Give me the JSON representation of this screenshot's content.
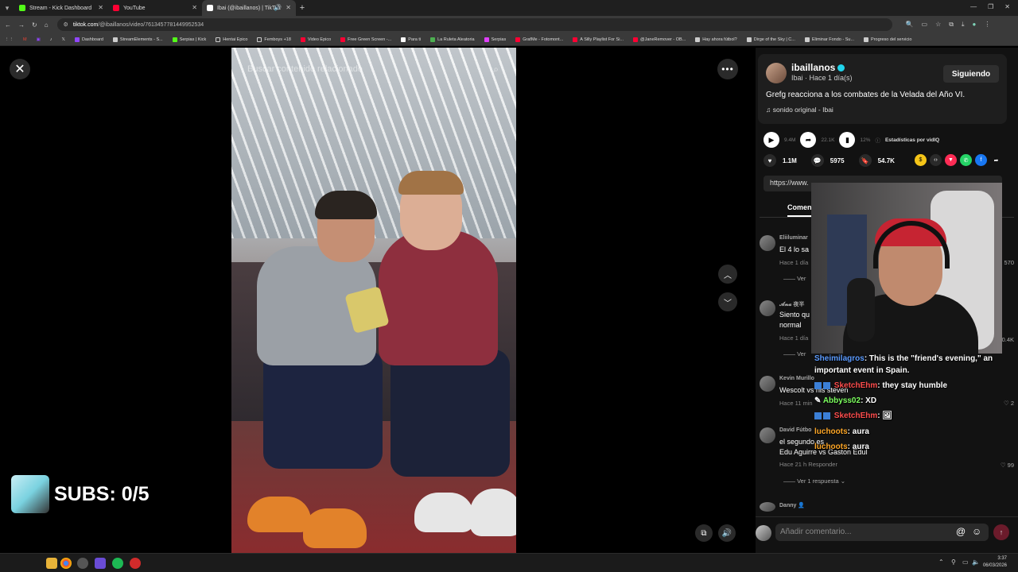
{
  "browser": {
    "tabs": [
      {
        "title": "Stream - Kick Dashboard",
        "color": "#53fc18",
        "active": false
      },
      {
        "title": "YouTube",
        "color": "#ff0033",
        "active": false
      },
      {
        "title": "Ibai (@ibaillanos) | TikTok",
        "color": "#ffffff",
        "active": true
      }
    ],
    "url_host": "tiktok.com",
    "url_path": "/@ibaillanos/video/7613457781449952534",
    "bookmarks": [
      {
        "label": "Dashboard",
        "color": "#9146ff"
      },
      {
        "label": "StreamElements - S...",
        "color": "#cccccc"
      },
      {
        "label": "Serpias | Kick",
        "color": "#53fc18"
      },
      {
        "label": "Hentai Epico",
        "color": "#cccccc"
      },
      {
        "label": "Femboys +18",
        "color": "#cccccc"
      },
      {
        "label": "Video Epico",
        "color": "#ff0033"
      },
      {
        "label": "Free Green Screen -...",
        "color": "#ff0033"
      },
      {
        "label": "Para ti",
        "color": "#ffffff"
      },
      {
        "label": "La Ruleta Aleatoria",
        "color": "#4caf50"
      },
      {
        "label": "Serpias",
        "color": "#e040fb"
      },
      {
        "label": "GrafMe - Fotomont...",
        "color": "#ff0033"
      },
      {
        "label": "A Silly Playlist For Si...",
        "color": "#ff0033"
      },
      {
        "label": "@JaneRemover - OB...",
        "color": "#ff0033"
      },
      {
        "label": "Hay ahora fútbol?",
        "color": "#cccccc"
      },
      {
        "label": "Dirge of the Sky | C...",
        "color": "#cccccc"
      },
      {
        "label": "Eliminar Fondo - Su...",
        "color": "#cccccc"
      },
      {
        "label": "Progreso del servicio",
        "color": "#cccccc"
      }
    ]
  },
  "video": {
    "search_placeholder": "Buscar contenido relacionado"
  },
  "overlay": {
    "subs_text": "SUBS: 0/5"
  },
  "post": {
    "username": "ibaillanos",
    "display_meta": "Ibai · Hace 1 día(s)",
    "follow_label": "Siguiendo",
    "description": "Grefg reacciona a los combates de la Velada del Año VI.",
    "sound": "sonido original - Ibai",
    "views": "9.4M",
    "shares_stat": "22.1K",
    "percent": "12%",
    "stats_label": "Estadísticas por vidIQ",
    "likes": "1.1M",
    "comments": "5975",
    "saves": "54.7K",
    "url_text": "https://www.",
    "comments_tab": "Comen"
  },
  "comments": [
    {
      "name": "Eliiluminar",
      "text": "El 4 lo sa",
      "meta": "Hace 1 día",
      "reply": "Ver",
      "likes": "570"
    },
    {
      "name": "𝓐𝓷𝓪 夜半",
      "text": "Siento qu\nnormal",
      "meta": "Hace 1 día",
      "reply": "Ver",
      "likes": "0.4K"
    },
    {
      "name": "Kevin Murillo",
      "text": "Wescolt vs his steven",
      "meta": "Hace 11 min",
      "reply": "",
      "likes": "2"
    },
    {
      "name": "David Fútbo",
      "text": "el segundo es\nEdu Aguirre vs Gaston Edul",
      "meta": "Hace 21 h   Responder",
      "reply": "Ver 1 respuesta",
      "likes": "99"
    },
    {
      "name": "Danny 👤",
      "text": "",
      "meta": "",
      "reply": "",
      "likes": ""
    }
  ],
  "comment_input": {
    "placeholder": "Añadir comentario..."
  },
  "chat": [
    {
      "user": "Sheimilagros",
      "color": "#5b9bff",
      "msg": ": This is the \"friend's evening,\" an important event in Spain."
    },
    {
      "user": "SketchEhm",
      "color": "#ff4d4d",
      "msg": ": they stay humble"
    },
    {
      "user": "Abbyss02",
      "color": "#7cff5e",
      "msg": ": XD"
    },
    {
      "user": "SketchEhm",
      "color": "#ff4d4d",
      "msg": ": 🖼"
    },
    {
      "user": "luchoots",
      "color": "#ffa726",
      "msg": ": aura"
    },
    {
      "user": "luchoots",
      "color": "#ffa726",
      "msg": ": aura"
    }
  ],
  "taskbar": {
    "time": "3:37",
    "date": "06/03/2026"
  }
}
